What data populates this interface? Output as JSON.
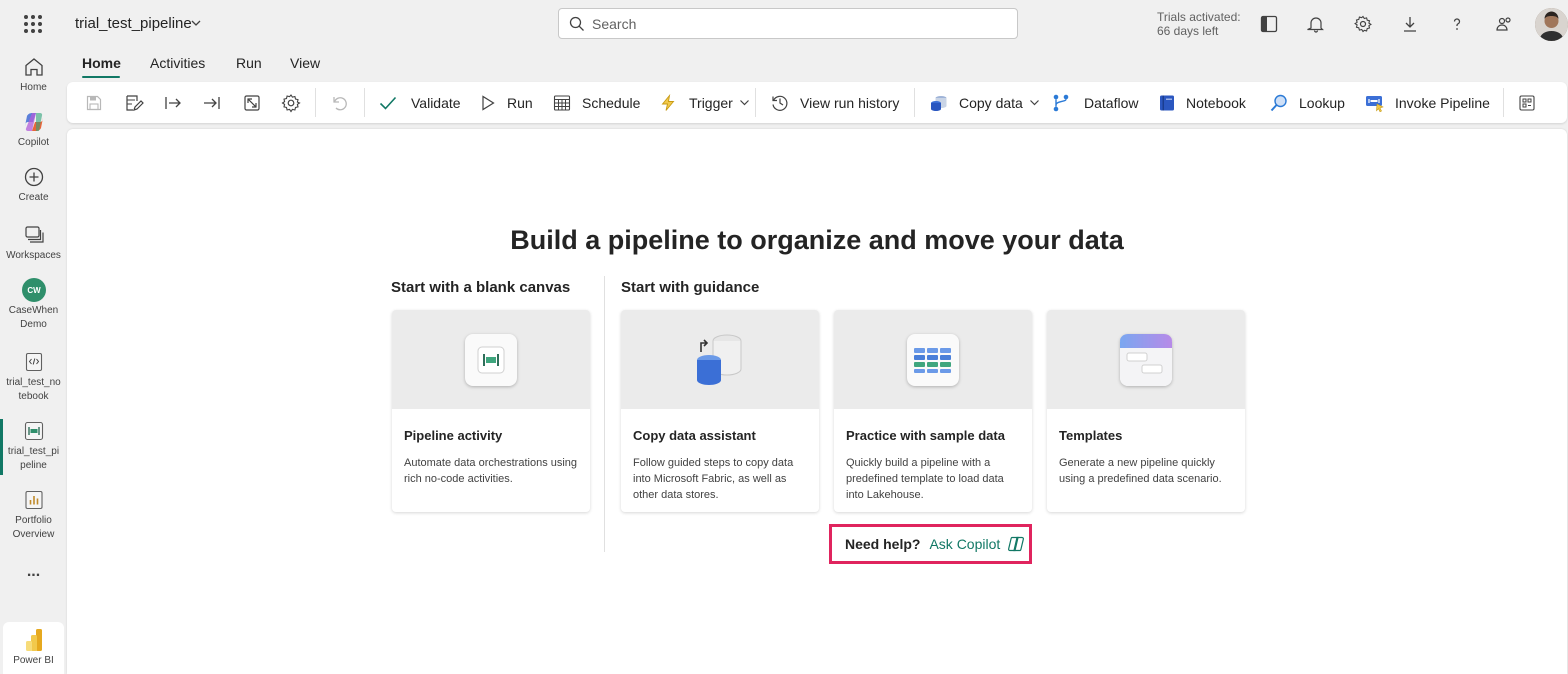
{
  "app": {
    "title": "trial_test_pipeline"
  },
  "search": {
    "placeholder": "Search"
  },
  "trial": {
    "line1": "Trials activated:",
    "line2": "66 days left"
  },
  "topbar_icons": [
    "panel-icon",
    "bell-icon",
    "gear-icon",
    "download-icon",
    "help-icon",
    "share-people-icon"
  ],
  "leftnav": {
    "items": [
      {
        "label": "Home",
        "icon": "home-icon"
      },
      {
        "label": "Copilot",
        "icon": "copilot-icon"
      },
      {
        "label": "Create",
        "icon": "plus-circle-icon"
      },
      {
        "label": "Workspaces",
        "icon": "workspaces-icon"
      },
      {
        "label": "CaseWhen Demo",
        "label_l1": "CaseWhen",
        "label_l2": "Demo",
        "icon": "workspace-logo-icon"
      },
      {
        "label": "trial_test_notebook",
        "label_l1": "trial_test_no",
        "label_l2": "tebook",
        "icon": "notebook-icon"
      },
      {
        "label": "trial_test_pipeline",
        "label_l1": "trial_test_pi",
        "label_l2": "peline",
        "icon": "pipeline-icon"
      },
      {
        "label": "Portfolio Overview",
        "label_l1": "Portfolio",
        "label_l2": "Overview",
        "icon": "report-icon"
      }
    ],
    "more": "...",
    "powerbi": "Power BI"
  },
  "tabs": [
    {
      "label": "Home",
      "selected": true
    },
    {
      "label": "Activities"
    },
    {
      "label": "Run"
    },
    {
      "label": "View"
    }
  ],
  "toolbar": {
    "validate": "Validate",
    "run": "Run",
    "schedule": "Schedule",
    "trigger": "Trigger",
    "view_run_history": "View run history",
    "copy_data": "Copy data",
    "dataflow": "Dataflow",
    "notebook": "Notebook",
    "lookup": "Lookup",
    "invoke_pipeline": "Invoke Pipeline"
  },
  "main": {
    "headline": "Build a pipeline to organize and move your data",
    "blank_title": "Start with a blank canvas",
    "guidance_title": "Start with guidance",
    "cards": [
      {
        "title": "Pipeline activity",
        "desc": "Automate data orchestrations using rich no-code activities."
      },
      {
        "title": "Copy data assistant",
        "desc": "Follow guided steps to copy data into Microsoft Fabric, as well as other data stores."
      },
      {
        "title": "Practice with sample data",
        "desc": "Quickly build a pipeline with a predefined template to load data into Lakehouse."
      },
      {
        "title": "Templates",
        "desc": "Generate a new pipeline quickly using a predefined data scenario."
      }
    ],
    "help_q": "Need help?",
    "help_link": "Ask Copilot"
  },
  "colors": {
    "accent": "#117865",
    "highlight": "#e0245e"
  }
}
